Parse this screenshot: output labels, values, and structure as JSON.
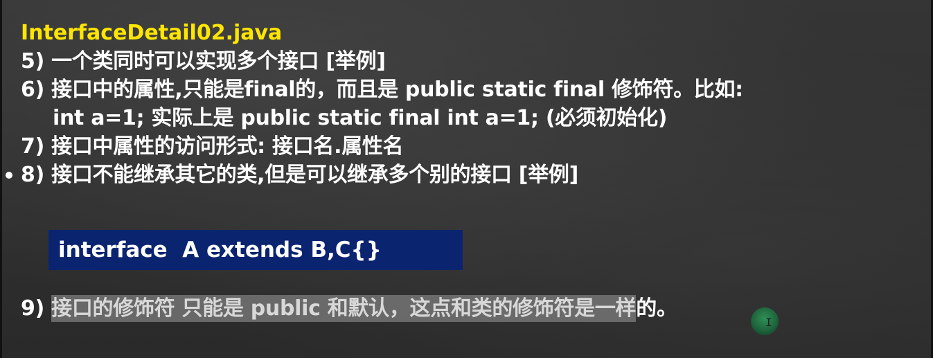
{
  "title": "InterfaceDetail02.java",
  "items": [
    {
      "num": "5)",
      "text": "一个类同时可以实现多个接口 [举例]"
    },
    {
      "num": "6)",
      "text": "接口中的属性,只能是final的，而且是 public static final 修饰符。比如:",
      "continuation": "int a=1; 实际上是 public static final int a=1; (必须初始化)"
    },
    {
      "num": "7)",
      "text": "接口中属性的访问形式: 接口名.属性名"
    },
    {
      "num": "8)",
      "text": "接口不能继承其它的类,但是可以继承多个别的接口 [举例]"
    }
  ],
  "code": "interface  A extends B,C{}",
  "item9": {
    "num": "9)",
    "highlighted": "接口的修饰符 只能是 public 和默认，这点和类的修饰符是一样",
    "tail": "的。"
  },
  "cursor_glyph": "I",
  "colors": {
    "title": "#ffe600",
    "code_bg": "#0b2470",
    "highlight": "#7d7d7d"
  }
}
